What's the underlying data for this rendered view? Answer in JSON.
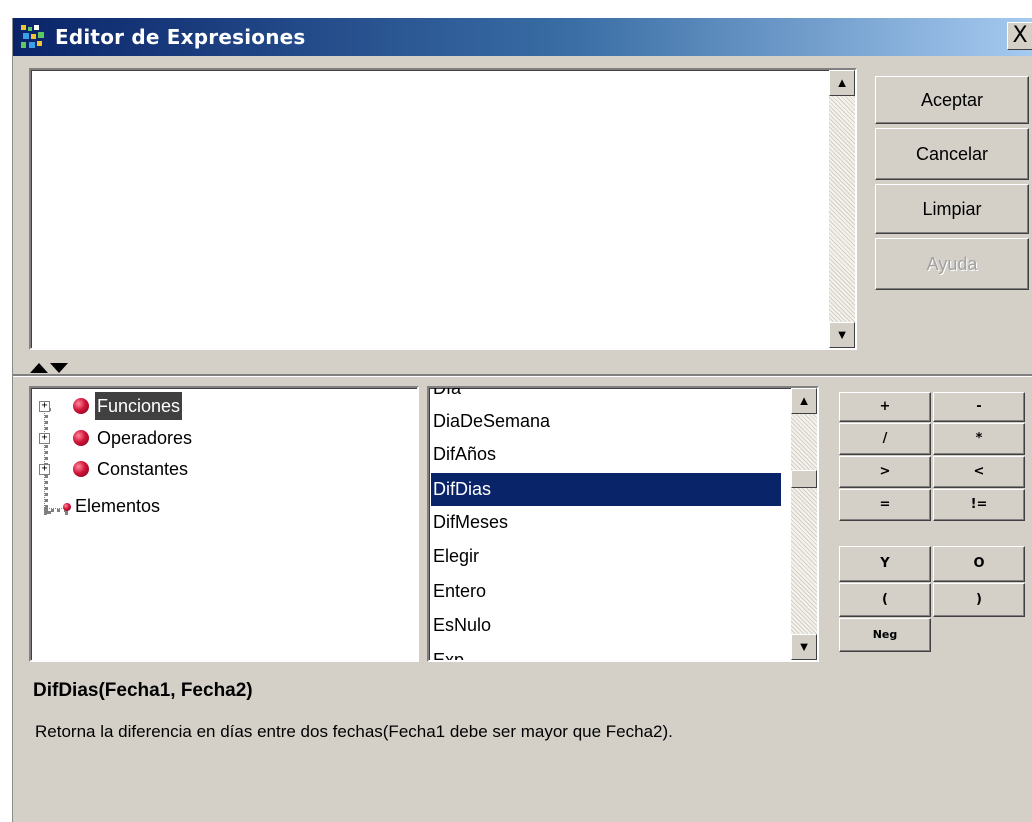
{
  "window": {
    "title": "Editor de Expresiones",
    "close_label": "X"
  },
  "expression": {
    "value": ""
  },
  "buttons": {
    "accept": "Aceptar",
    "cancel": "Cancelar",
    "clear": "Limpiar",
    "help": "Ayuda"
  },
  "splitter": {
    "icon": "up-down-arrows-icon"
  },
  "tree": {
    "items": [
      {
        "label": "Funciones",
        "selected": true
      },
      {
        "label": "Operadores",
        "selected": false
      },
      {
        "label": "Constantes",
        "selected": false
      },
      {
        "label": "Elementos",
        "selected": false
      }
    ]
  },
  "functions_list": {
    "items": [
      "Día",
      "DiaDeSemana",
      "DifAños",
      "DifDias",
      "DifMeses",
      "Elegir",
      "Entero",
      "EsNulo",
      "Exp..."
    ],
    "selected": "DifDias"
  },
  "operators": {
    "row1": [
      "+",
      "-"
    ],
    "row2": [
      "/",
      "*"
    ],
    "row3": [
      ">",
      "<"
    ],
    "row4": [
      "=",
      "!="
    ],
    "logic": [
      "Y",
      "O",
      "(",
      ")",
      "Neg"
    ]
  },
  "description": {
    "signature": "DifDias(Fecha1, Fecha2)",
    "text": "Retorna la diferencia en días entre dos fechas(Fecha1 debe ser mayor que Fecha2)."
  },
  "colors": {
    "selection": "#0a246a",
    "titlebar": "#0a246a",
    "face": "#d4d0c8",
    "ball": "#d0143a"
  }
}
